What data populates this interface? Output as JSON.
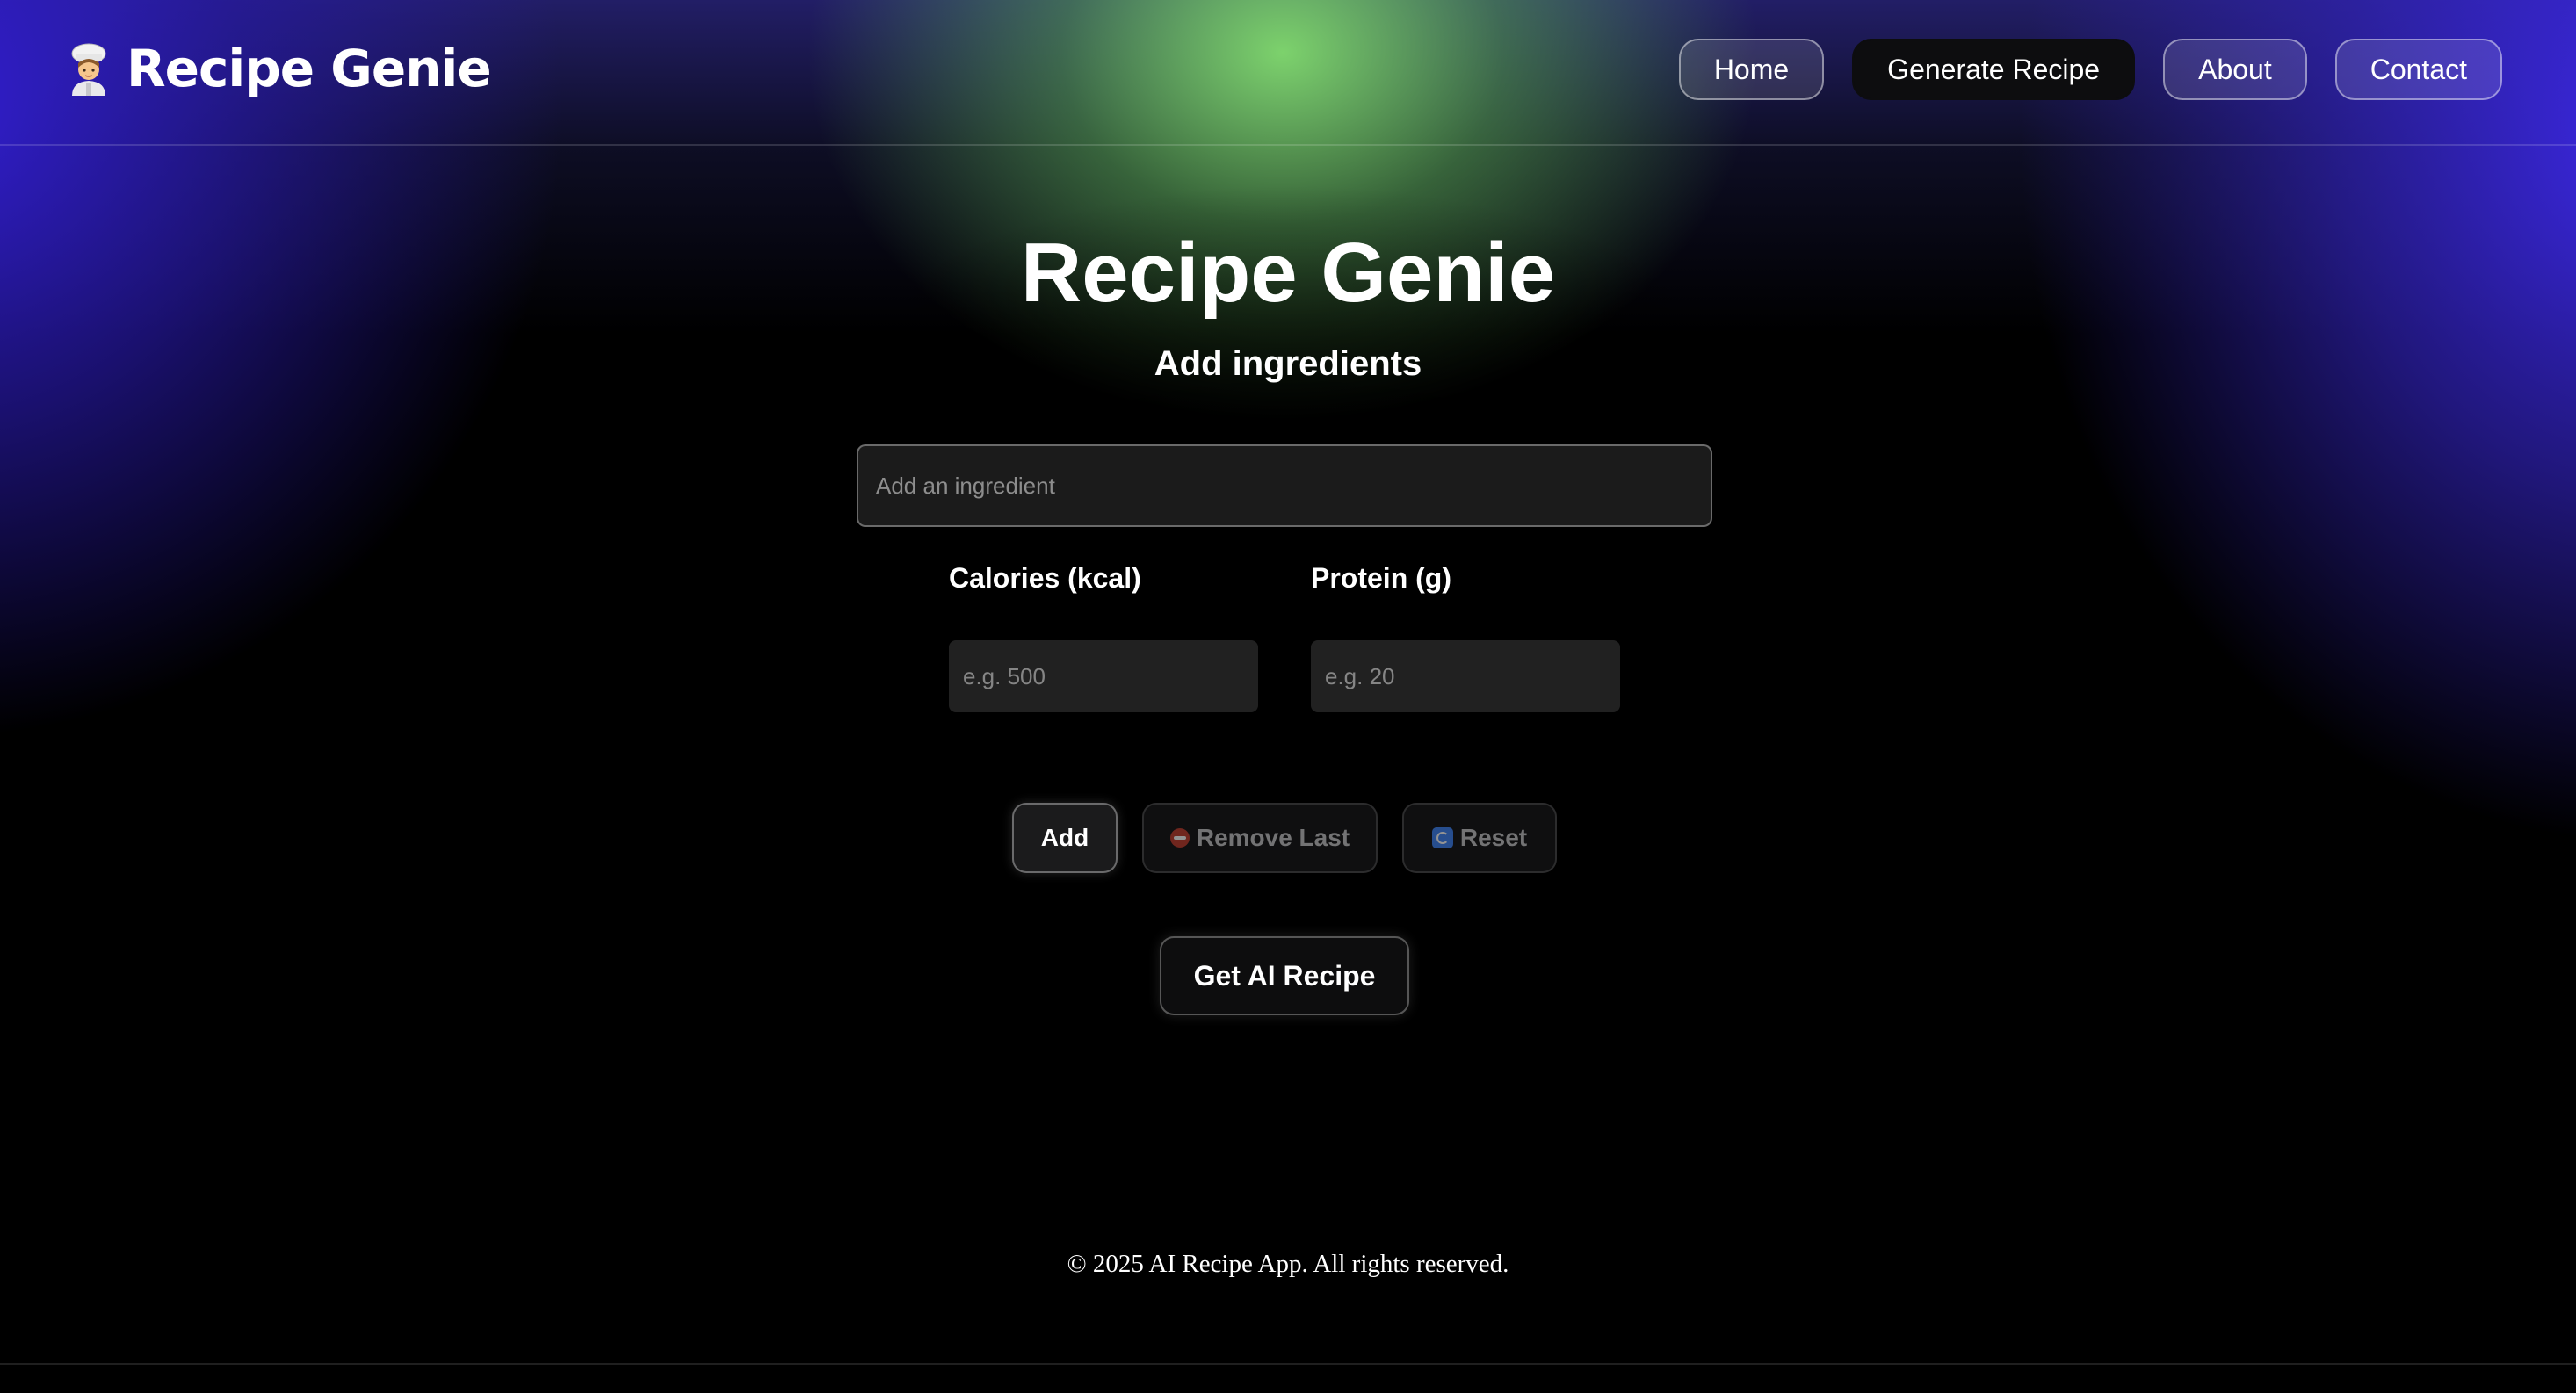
{
  "header": {
    "brand_icon": "chef-emoji-icon",
    "brand_title": "Recipe Genie",
    "nav": [
      {
        "label": "Home",
        "active": false
      },
      {
        "label": "Generate Recipe",
        "active": true
      },
      {
        "label": "About",
        "active": false
      },
      {
        "label": "Contact",
        "active": false
      }
    ]
  },
  "main": {
    "title": "Recipe Genie",
    "subtitle": "Add ingredients",
    "ingredient_input": {
      "value": "",
      "placeholder": "Add an ingredient"
    },
    "calories": {
      "label": "Calories (kcal)",
      "value": "",
      "placeholder": "e.g. 500"
    },
    "protein": {
      "label": "Protein (g)",
      "value": "",
      "placeholder": "e.g. 20"
    },
    "buttons": {
      "add": "Add",
      "remove_last": "Remove Last",
      "remove_icon": "minus-circle-icon",
      "reset": "Reset",
      "reset_icon": "refresh-icon",
      "get_ai_recipe": "Get AI Recipe"
    }
  },
  "footer": {
    "text": "© 2025 AI Recipe App. All rights reserved."
  },
  "colors": {
    "background": "#000000",
    "glow_green": "#82dc6e",
    "glow_blue": "#3c28e6",
    "active_nav": "#0d0d0f"
  }
}
